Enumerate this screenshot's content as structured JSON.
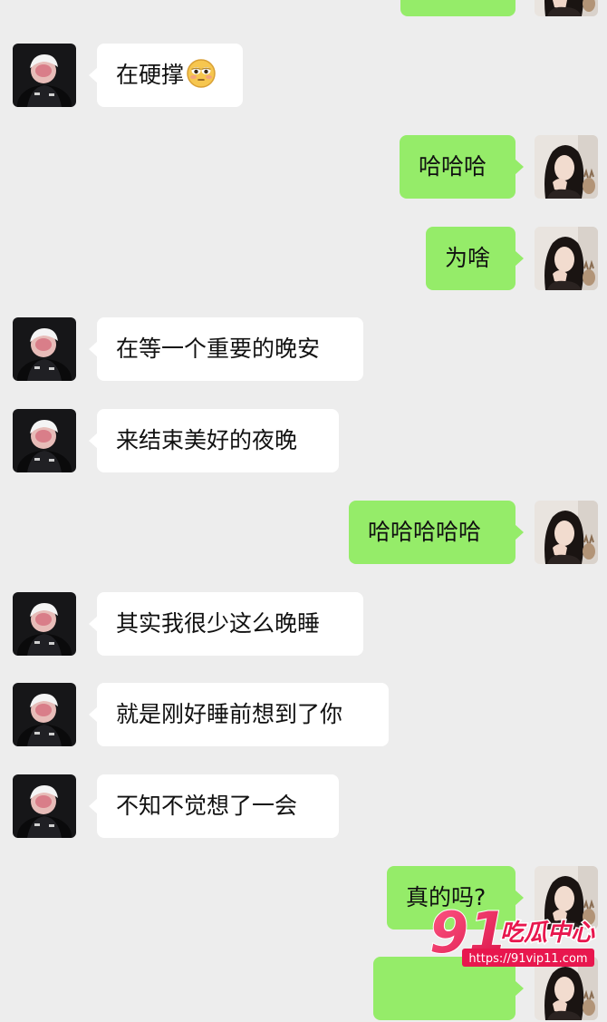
{
  "conversation": {
    "messages": [
      {
        "side": "right",
        "text": "",
        "avatar": "female-avatar"
      },
      {
        "side": "left",
        "text": "在硬撑",
        "emoji": "flushed-face-emoji",
        "avatar": "male-avatar"
      },
      {
        "side": "right",
        "text": "哈哈哈",
        "avatar": "female-avatar"
      },
      {
        "side": "right",
        "text": "为啥",
        "avatar": "female-avatar"
      },
      {
        "side": "left",
        "text": "在等一个重要的晚安",
        "avatar": "male-avatar"
      },
      {
        "side": "left",
        "text": "来结束美好的夜晚",
        "avatar": "male-avatar"
      },
      {
        "side": "right",
        "text": "哈哈哈哈哈",
        "avatar": "female-avatar"
      },
      {
        "side": "left",
        "text": "其实我很少这么晚睡",
        "avatar": "male-avatar"
      },
      {
        "side": "left",
        "text": "就是刚好睡前想到了你",
        "avatar": "male-avatar"
      },
      {
        "side": "left",
        "text": "不知不觉想了一会",
        "avatar": "male-avatar"
      },
      {
        "side": "right",
        "text": "真的吗?",
        "avatar": "female-avatar"
      },
      {
        "side": "right",
        "text": "",
        "avatar": "female-avatar"
      }
    ]
  },
  "watermark": {
    "number": "91",
    "brand": "吃瓜中心",
    "url": "https://91vip11.com"
  },
  "colors": {
    "background": "#ededed",
    "incoming_bubble": "#ffffff",
    "outgoing_bubble": "#95ec69",
    "watermark": "#e8174e"
  }
}
